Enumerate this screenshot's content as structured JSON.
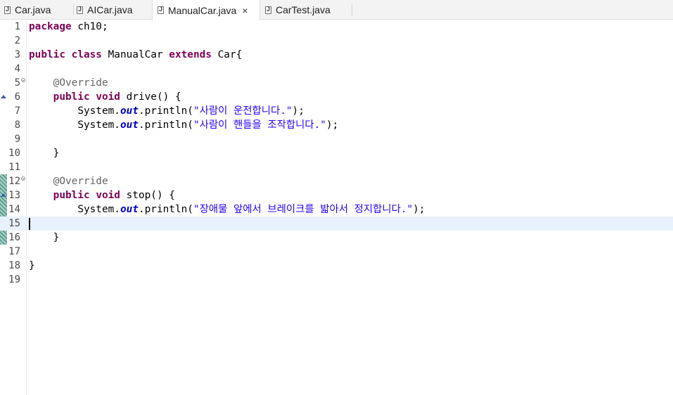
{
  "tabs": [
    {
      "label": "Car.java",
      "active": false
    },
    {
      "label": "AICar.java",
      "active": false
    },
    {
      "label": "ManualCar.java",
      "active": true,
      "close": "×"
    },
    {
      "label": "CarTest.java",
      "active": false
    }
  ],
  "editor": {
    "current_line": 15,
    "lines": [
      {
        "n": "1"
      },
      {
        "n": "2"
      },
      {
        "n": "3"
      },
      {
        "n": "4"
      },
      {
        "n": "5"
      },
      {
        "n": "6"
      },
      {
        "n": "7"
      },
      {
        "n": "8"
      },
      {
        "n": "9"
      },
      {
        "n": "10"
      },
      {
        "n": "11"
      },
      {
        "n": "12"
      },
      {
        "n": "13"
      },
      {
        "n": "14"
      },
      {
        "n": "15"
      },
      {
        "n": "16"
      },
      {
        "n": "17"
      },
      {
        "n": "18"
      },
      {
        "n": "19"
      }
    ],
    "tokens": {
      "l1_kw": "package",
      "l1_rest": " ch10;",
      "l3_kw1": "public",
      "l3_kw2": "class",
      "l3_name": " ManualCar ",
      "l3_kw3": "extends",
      "l3_rest": " Car{",
      "l5_ann": "@Override",
      "l6_kw1": "public",
      "l6_kw2": "void",
      "l6_rest": " drive() {",
      "l7_a": "System.",
      "l7_field": "out",
      "l7_b": ".println(",
      "l7_str": "\"사람이 운전합니다.\"",
      "l7_c": ");",
      "l8_a": "System.",
      "l8_field": "out",
      "l8_b": ".println(",
      "l8_str": "\"사람이 핸들을 조작합니다.\"",
      "l8_c": ");",
      "l10_brace": "}",
      "l12_ann": "@Override",
      "l13_kw1": "public",
      "l13_kw2": "void",
      "l13_rest": " stop() {",
      "l14_a": "System.",
      "l14_field": "out",
      "l14_b": ".println(",
      "l14_str": "\"장애물 앞에서 브레이크를 밟아서 정지합니다.\"",
      "l14_c": ");",
      "l16_brace": "}",
      "l18_brace": "}"
    }
  },
  "icons": {
    "file_icon": "java-file-icon",
    "fold_icon": "collapse-icon",
    "override_icon": "override-triangle-icon"
  },
  "colors": {
    "keyword": "#7f0055",
    "annotation": "#646464",
    "static_field": "#0000c0",
    "string": "#2a00ff",
    "current_line": "#e8f2fe",
    "change_marker": "#7fb3a8"
  }
}
